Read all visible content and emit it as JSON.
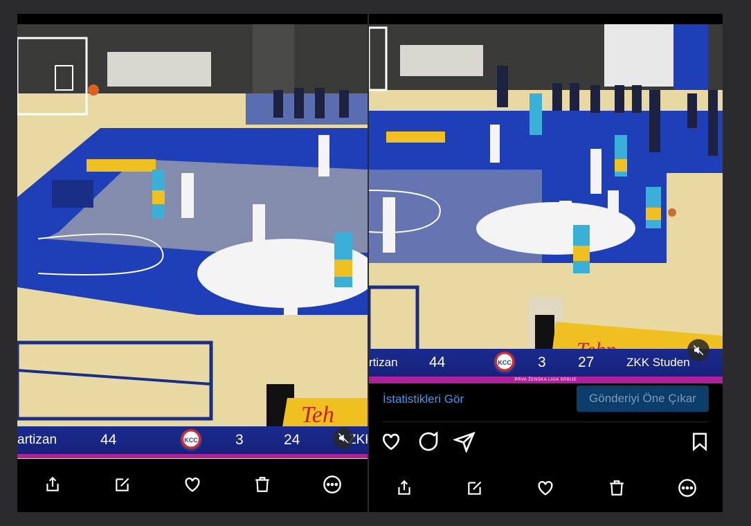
{
  "left": {
    "scoreboard": {
      "team_home": "artizan",
      "score_home": "44",
      "logo": "KCC",
      "quarter": "3",
      "clock": "24",
      "team_away": "ZKK"
    },
    "toolbar": {
      "share": "share-icon",
      "edit": "edit-icon",
      "like": "heart-icon",
      "delete": "trash-icon",
      "more": "more-icon"
    }
  },
  "right": {
    "scoreboard": {
      "team_home": "rtizan",
      "score_home": "44",
      "logo": "KCC",
      "quarter": "3",
      "clock": "27",
      "team_away": "ZKK Studen",
      "league": "PRVA ŽENSKA LIGA SRBIJE"
    },
    "actions": {
      "stats_link": "İstatistikleri Gör",
      "promote_button": "Gönderiyi Öne Çıkar"
    },
    "toolbar": {
      "share": "share-icon",
      "edit": "edit-icon",
      "like": "heart-icon",
      "delete": "trash-icon",
      "more": "more-icon"
    }
  },
  "colors": {
    "court_blue": "#1f3fb8",
    "court_wood": "#e8d9a2",
    "scoreboard_blue": "#1b2b8f",
    "scoreboard_accent": "#b0209a",
    "link_blue": "#3d9bf0",
    "promote_bg": "#0b3d6b"
  }
}
